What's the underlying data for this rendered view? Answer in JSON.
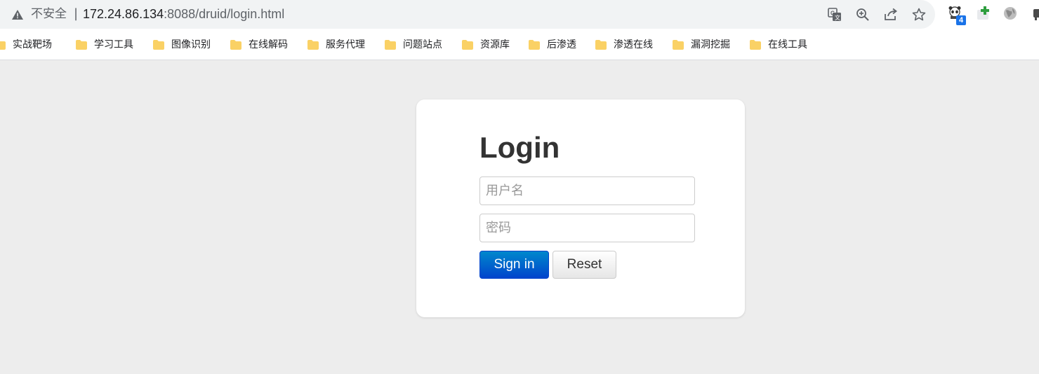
{
  "browser": {
    "security_label": "不安全",
    "separator": "|",
    "url_host": "172.24.86.134",
    "url_rest": ":8088/druid/login.html",
    "toolbar_icons": [
      "translate-icon",
      "zoom-icon",
      "share-icon",
      "bookmark-star-icon"
    ],
    "extensions": [
      {
        "name": "extension-panda-icon",
        "badge": "4"
      },
      {
        "name": "extension-plus-icon"
      },
      {
        "name": "extension-globe-icon"
      },
      {
        "name": "extension-partial-icon"
      }
    ]
  },
  "bookmarks": [
    {
      "label": "实战靶场"
    },
    {
      "label": "学习工具"
    },
    {
      "label": "图像识别"
    },
    {
      "label": "在线解码"
    },
    {
      "label": "服务代理"
    },
    {
      "label": "问题站点"
    },
    {
      "label": "资源库"
    },
    {
      "label": "后渗透"
    },
    {
      "label": "渗透在线"
    },
    {
      "label": "漏洞挖掘"
    },
    {
      "label": "在线工具"
    }
  ],
  "login": {
    "title": "Login",
    "username_placeholder": "用户名",
    "password_placeholder": "密码",
    "signin_label": "Sign in",
    "reset_label": "Reset"
  },
  "colors": {
    "page_background": "#ededed",
    "primary_button": "#0044cc",
    "folder_icon": "#fad165"
  }
}
